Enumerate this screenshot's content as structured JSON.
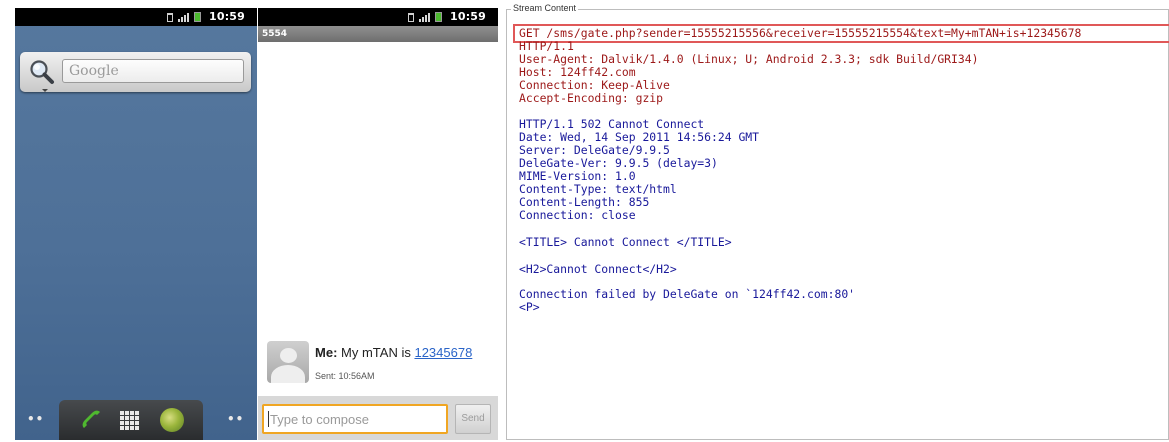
{
  "home": {
    "status_time": "10:59",
    "search_placeholder": "Google"
  },
  "messaging": {
    "status_time": "10:59",
    "contact": "5554",
    "message": {
      "sender": "Me",
      "body": "My mTAN is",
      "link_number": "12345678",
      "sent": "Sent: 10:56AM"
    },
    "compose_placeholder": "Type to compose",
    "send_label": "Send"
  },
  "stream": {
    "title": "Stream Content",
    "request_lines": [
      "GET /sms/gate.php?sender=15555215556&receiver=15555215554&text=My+mTAN+is+12345678",
      "HTTP/1.1",
      "User-Agent: Dalvik/1.4.0 (Linux; U; Android 2.3.3; sdk Build/GRI34)",
      "Host: 124ff42.com",
      "Connection: Keep-Alive",
      "Accept-Encoding: gzip"
    ],
    "response_lines": [
      "HTTP/1.1 502 Cannot Connect",
      "Date: Wed, 14 Sep 2011 14:56:24 GMT",
      "Server: DeleGate/9.9.5",
      "DeleGate-Ver: 9.9.5 (delay=3)",
      "MIME-Version: 1.0",
      "Content-Type: text/html",
      "Content-Length: 855",
      "Connection: close",
      "<TITLE> Cannot Connect </TITLE>",
      "<H2>Cannot Connect</H2>",
      "Connection failed by DeleGate on `124ff42.com:80'",
      "<P>"
    ]
  }
}
